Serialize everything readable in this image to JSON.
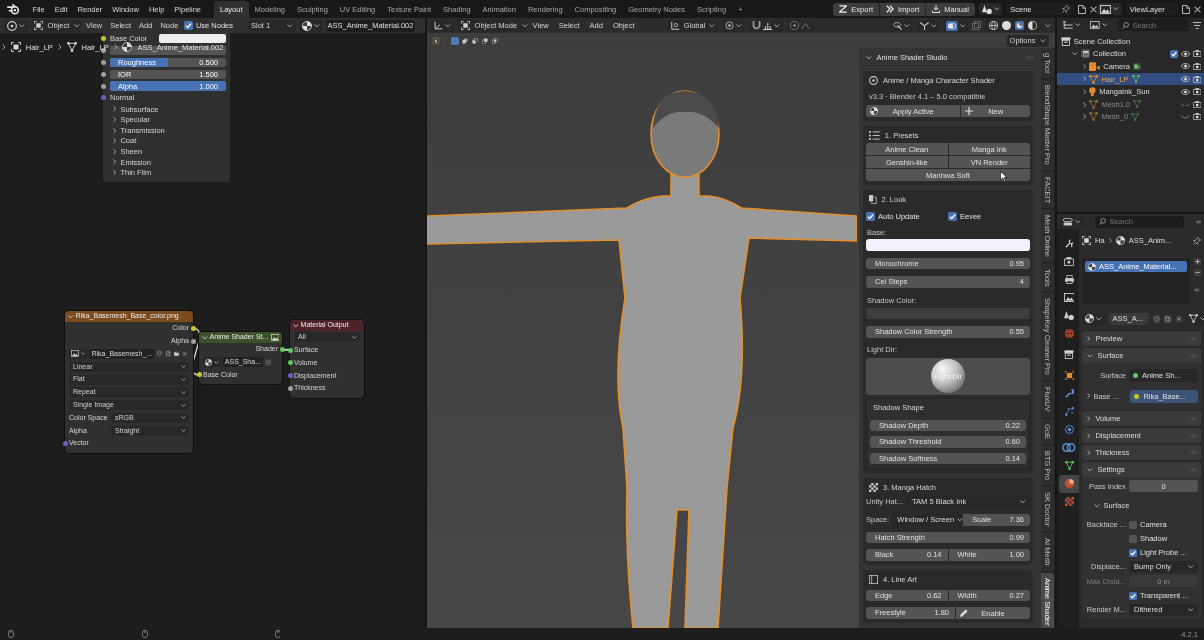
{
  "top_bar": {
    "menus": [
      "File",
      "Edit",
      "Render",
      "Window",
      "Help",
      "Pipeline"
    ],
    "workspaces": [
      {
        "label": "Layout",
        "selected": true
      },
      {
        "label": "Modeling",
        "selected": false
      },
      {
        "label": "Sculpting",
        "selected": false
      },
      {
        "label": "UV Editing",
        "selected": false
      },
      {
        "label": "Texture Paint",
        "selected": false
      },
      {
        "label": "Shading",
        "selected": false
      },
      {
        "label": "Animation",
        "selected": false
      },
      {
        "label": "Rendering",
        "selected": false
      },
      {
        "label": "Compositing",
        "selected": false
      },
      {
        "label": "Geometry Nodes",
        "selected": false
      },
      {
        "label": "Scripting",
        "selected": false
      }
    ],
    "add_workspace": "+",
    "actions": [
      "Export",
      "Import",
      "Manual"
    ],
    "scene": "Scene",
    "view_layer": "ViewLayer"
  },
  "node_editor": {
    "header": {
      "mode": "Object",
      "menus": [
        "View",
        "Select",
        "Add",
        "Node"
      ],
      "use_nodes": {
        "label": "Use Nodes",
        "checked": true
      },
      "slot": "Slot 1",
      "material": "ASS_Anime_Material.002"
    },
    "breadcrumbs": [
      "Hair_LP",
      "Hair_LP",
      "ASS_Anime_Material.002"
    ],
    "bsdf_inputs": [
      {
        "kind": "color",
        "label": "Base Color",
        "color": "#c7c729",
        "swatch": {
          "color": "#eeeeee"
        }
      },
      {
        "kind": "blank",
        "color": "#a1a1a1"
      },
      {
        "kind": "factor",
        "label": "Roughness",
        "value": "0.500",
        "level": 0.5,
        "color": "#a1a1a1"
      },
      {
        "kind": "number",
        "label": "IOR",
        "value": "1.500",
        "color": "#a1a1a1"
      },
      {
        "kind": "factor",
        "label": "Alpha",
        "value": "1.000",
        "level": 1,
        "color": "#a1a1a1"
      },
      {
        "kind": "socket",
        "label": "Normal",
        "color": "#6363c7"
      }
    ],
    "bsdf_panels": [
      {
        "label": "Subsurface",
        "expanded": false
      },
      {
        "label": "Specular",
        "expanded": false
      },
      {
        "label": "Transmission",
        "expanded": false
      },
      {
        "label": "Coat",
        "expanded": false
      },
      {
        "label": "Sheen",
        "expanded": false
      },
      {
        "label": "Emission",
        "expanded": false
      },
      {
        "label": "Thin Film",
        "expanded": false
      }
    ],
    "nodes": [
      {
        "kind": "texture",
        "title": "Rika_Basemesh_Base_color.png",
        "outputs": [
          {
            "label": "Color",
            "color": "#c7c729"
          },
          {
            "label": "Alpha",
            "color": "#a1a1a1"
          }
        ],
        "image": "Rika_Basemesh_...",
        "dropdowns": [
          "Linear",
          "Flat",
          "Repeat",
          "Single Image"
        ],
        "properties": [
          {
            "label": "Color Space",
            "value": "sRGB"
          },
          {
            "label": "Alpha",
            "value": "Straight"
          }
        ],
        "inputs": [
          {
            "label": "Vector",
            "color": "#6363c7"
          }
        ]
      },
      {
        "kind": "group",
        "title": "Anime Shader St...",
        "outputs": [
          {
            "label": "Shader",
            "color": "#63c763"
          }
        ],
        "datablock": "ASS_Sha...",
        "inputs": [
          {
            "label": "Base Color",
            "color": "#c7c729"
          }
        ]
      },
      {
        "kind": "output",
        "title": "Material Output",
        "dropdowns": [
          "All"
        ],
        "inputs": [
          {
            "label": "Surface",
            "color": "#63c763"
          },
          {
            "label": "Volume",
            "color": "#63c763"
          },
          {
            "label": "Displacement",
            "color": "#6363c7"
          },
          {
            "label": "Thickness",
            "color": "#a1a1a1"
          }
        ]
      }
    ]
  },
  "viewport": {
    "header": {
      "mode": "Object Mode",
      "menus": [
        "View",
        "Select",
        "Add",
        "Object"
      ],
      "orientation": "Global",
      "shading_modes": [
        {
          "selected": false
        },
        {
          "selected": false
        },
        {
          "selected": true
        },
        {
          "selected": false
        }
      ]
    },
    "select_modes": [
      {
        "selected": true
      },
      {
        "selected": false
      },
      {
        "selected": false
      },
      {
        "selected": false
      },
      {
        "selected": false
      }
    ],
    "options": "Options",
    "sidebar": {
      "title": "Anime Shader Studio",
      "intro": {
        "title": "Anime / Manga Character Shader",
        "version": "v3.3 · Blender 4.1 – 5.0 compatible",
        "buttons": [
          "Apply Active",
          "New"
        ]
      },
      "presets": {
        "title": "1. Presets",
        "items": [
          "Anime Clean",
          "Manga Ink",
          "Genshin-like",
          "VN Render",
          "Manhwa Soft"
        ]
      },
      "look": {
        "title": "2. Look",
        "toggles": [
          {
            "label": "Auto Update",
            "checked": true
          },
          {
            "label": "Eevee",
            "checked": true
          }
        ],
        "base": {
          "label": "Base:",
          "color": "#f2f0fa"
        },
        "fields": [
          {
            "label": "Monochrome",
            "value": "0.95"
          },
          {
            "label": "Cel Steps",
            "value": "4"
          }
        ],
        "shadow_color": {
          "label": "Shadow Color:",
          "color": "#3d3d3d"
        },
        "shadow_strength": {
          "label": "Shadow Color Strength",
          "value": "0.55"
        },
        "light_dir": {
          "label": "Light Dir:",
          "text": "Light Dir"
        },
        "shadow_shape": {
          "title": "Shadow Shape",
          "fields": [
            {
              "label": "Shadow Depth",
              "value": "0.22"
            },
            {
              "label": "Shadow Threshold",
              "value": "0.60"
            },
            {
              "label": "Shadow Softness",
              "value": "0.14"
            }
          ]
        }
      },
      "hatch": {
        "title": "3. Manga Hatch",
        "unity": {
          "label": "Unity Hat...",
          "value": "TAM 5 Black Ink"
        },
        "space": {
          "label": "Space:",
          "value": "Window / Screen"
        },
        "scale": {
          "label": "Scale",
          "value": "7.36"
        },
        "strength": {
          "label": "Hatch Strength",
          "value": "0.99"
        },
        "pair": [
          {
            "label": "Black",
            "value": "0.14"
          },
          {
            "label": "White",
            "value": "1.00"
          }
        ]
      },
      "line_art": {
        "title": "4. Line Art",
        "pair": [
          {
            "label": "Edge",
            "value": "0.62"
          },
          {
            "label": "Width",
            "value": "0.27"
          }
        ],
        "freestyle": {
          "label": "Freestyle",
          "value": "1.80"
        },
        "enable": "Enable"
      }
    },
    "sidebar_tabs": [
      {
        "label": "g Tool",
        "selected": false
      },
      {
        "label": "BlendShape Master Pro",
        "selected": false
      },
      {
        "label": "FACEIT",
        "selected": false
      },
      {
        "label": "Mesh Online",
        "selected": false
      },
      {
        "label": "Tools",
        "selected": false
      },
      {
        "label": "ShapeKey Cleaner Pro",
        "selected": false
      },
      {
        "label": "FluxUV",
        "selected": false
      },
      {
        "label": "GoE",
        "selected": false
      },
      {
        "label": "BTG Pro",
        "selected": false
      },
      {
        "label": "SK Doctor",
        "selected": false
      },
      {
        "label": "AI Mesh",
        "selected": false
      },
      {
        "label": "Anime Shader",
        "selected": true
      }
    ]
  },
  "outliner": {
    "search_placeholder": "Search",
    "tree": [
      {
        "kind": "scene_collection",
        "label": "Scene Collection",
        "children": [
          {
            "kind": "collection",
            "label": "Collection",
            "expanded": true,
            "checked": true,
            "children": [
              {
                "kind": "camera",
                "label": "Camera",
                "expanded": false,
                "selected": false,
                "visible": true
              },
              {
                "kind": "mesh",
                "label": "Hair_LP",
                "expanded": false,
                "selected": true,
                "visible": true
              },
              {
                "kind": "light",
                "label": "MangaInk_Sun",
                "expanded": false,
                "selected": false,
                "visible": true
              },
              {
                "kind": "mesh",
                "label": "Mesh1.0",
                "expanded": false,
                "selected": false,
                "visible": false
              },
              {
                "kind": "mesh",
                "label": "Mesh_0",
                "expanded": false,
                "selected": false,
                "visible": false
              }
            ]
          }
        ]
      }
    ]
  },
  "properties": {
    "search_placeholder": "Search",
    "tabs": [
      {
        "selected": false
      },
      {
        "selected": false
      },
      {
        "selected": false
      },
      {
        "selected": false
      },
      {
        "selected": false
      },
      {
        "selected": false
      },
      {
        "selected": false
      },
      {
        "selected": false
      },
      {
        "selected": false
      },
      {
        "selected": false
      },
      {
        "selected": false
      },
      {
        "selected": false
      },
      {
        "selected": false
      },
      {
        "selected": true
      },
      {
        "selected": false
      }
    ],
    "breadcrumbs": [
      "Ha",
      "ASS_Anim..."
    ],
    "slots": [
      {
        "label": "ASS_Anime_Material...",
        "selected": true
      }
    ],
    "material": "ASS_A...",
    "panels": [
      {
        "title": "Preview",
        "expanded": false
      },
      {
        "title": "Surface",
        "expanded": true,
        "rows": [
          {
            "kind": "link",
            "label": "Surface",
            "value": "Anime Sh...",
            "color": "#63c763",
            "highlighted": false
          },
          {
            "kind": "link_expand",
            "label": "Base ...",
            "value": "Rika_Base...",
            "color": "#c7c729",
            "highlighted": true,
            "expanded": false
          }
        ]
      },
      {
        "title": "Volume",
        "expanded": false
      },
      {
        "title": "Displacement",
        "expanded": false
      },
      {
        "title": "Thickness",
        "expanded": false
      },
      {
        "title": "Settings",
        "expanded": true,
        "rows": [
          {
            "kind": "number",
            "label": "Pass Index",
            "value": "0",
            "disabled": false
          },
          {
            "kind": "subpanel",
            "label": "Surface",
            "expanded": true
          },
          {
            "kind": "check",
            "label": "Backface ...",
            "text": "Camera",
            "checked": false
          },
          {
            "kind": "check",
            "text": "Shadow",
            "checked": false
          },
          {
            "kind": "check",
            "text": "Light Probe ...",
            "checked": true
          },
          {
            "kind": "dropdown",
            "label": "Displace...",
            "value": "Bump Only"
          },
          {
            "kind": "number",
            "label": "Max Dista...",
            "value": "0 m",
            "disabled": true
          },
          {
            "kind": "check",
            "text": "Transparent ...",
            "checked": true
          },
          {
            "kind": "dropdown",
            "label": "Render M...",
            "value": "Dithered"
          }
        ]
      }
    ]
  },
  "status_bar": {
    "version": "4.2.1"
  }
}
